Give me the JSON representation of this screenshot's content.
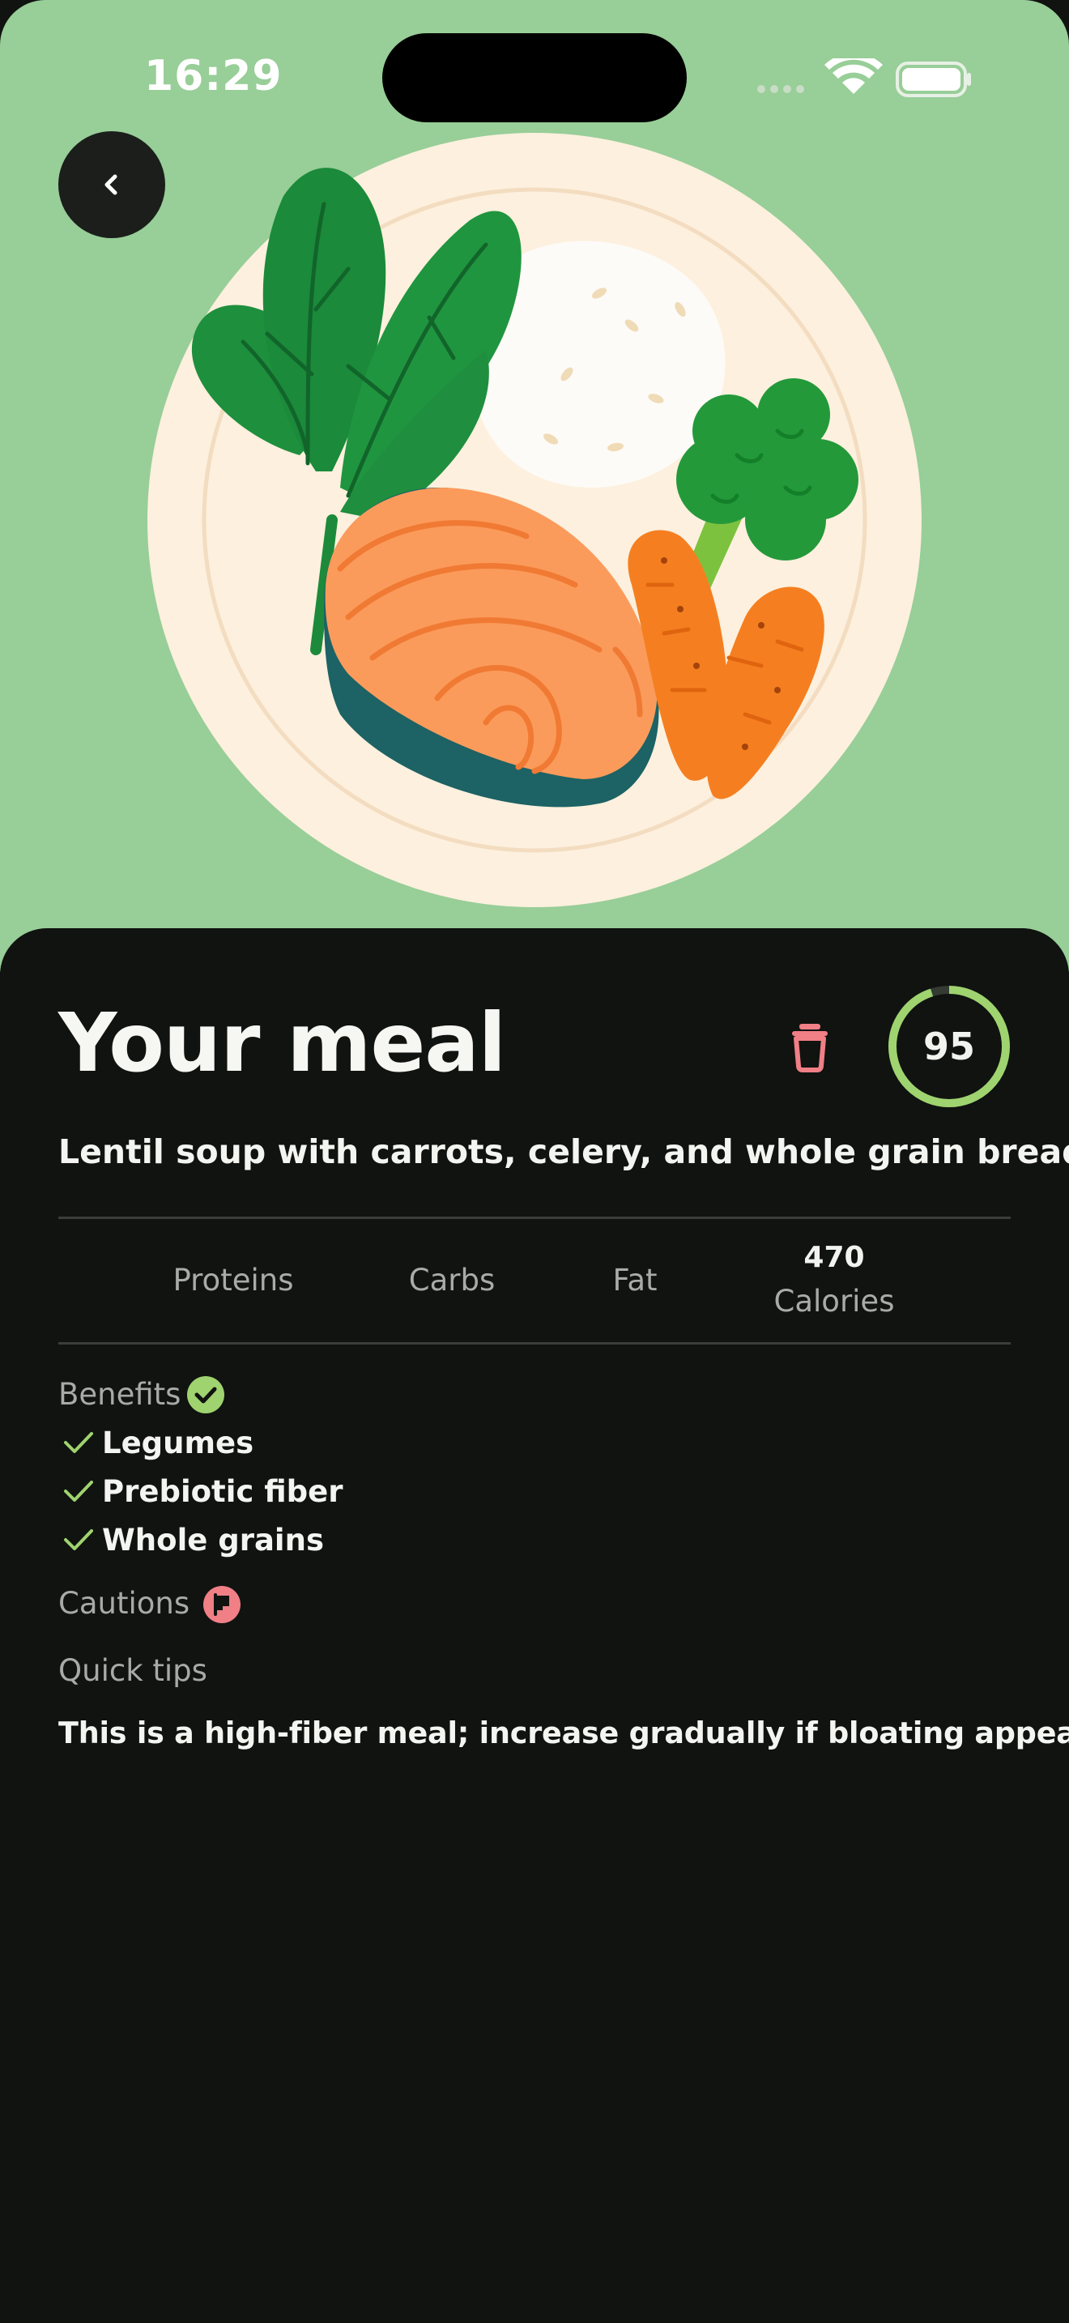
{
  "status_bar": {
    "time": "16:29"
  },
  "header": {
    "back_icon": "chevron-left-icon",
    "hero_image": "meal-plate-illustration"
  },
  "meal": {
    "title": "Your meal",
    "delete_icon": "trash-icon",
    "score": "95",
    "score_fraction": 0.95,
    "description": "Lentil soup with carrots, celery, and whole grain bread"
  },
  "macros": {
    "proteins_label": "Proteins",
    "carbs_label": "Carbs",
    "fat_label": "Fat",
    "calories_value": "470",
    "calories_label": "Calories"
  },
  "benefits": {
    "label": "Benefits",
    "icon": "check-circle-icon",
    "items": [
      "Legumes",
      "Prebiotic fiber",
      "Whole grains"
    ]
  },
  "cautions": {
    "label": "Cautions",
    "icon": "flag-icon"
  },
  "tips": {
    "label": "Quick tips",
    "text": "This is a high-fiber meal; increase gradually if bloating appears."
  },
  "colors": {
    "hero_bg": "#98ce98",
    "sheet_bg": "#101310",
    "accent_green": "#9fd36f",
    "accent_red": "#f07f86"
  }
}
